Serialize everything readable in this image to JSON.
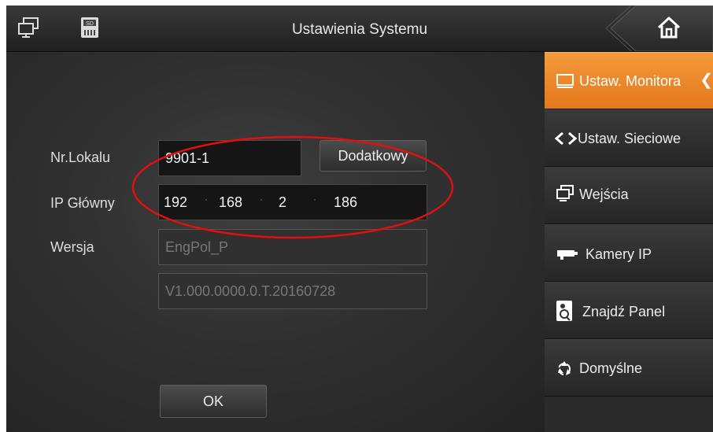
{
  "header": {
    "title": "Ustawienia Systemu",
    "icons": [
      "monitor-icon",
      "sd-card-icon"
    ],
    "home_icon": "home-icon"
  },
  "form": {
    "room_label": "Nr.Lokalu",
    "room_value": "9901-1",
    "extra_button": "Dodatkowy",
    "ip_label": "IP Główny",
    "ip": [
      "192",
      "168",
      "2",
      "186"
    ],
    "version_label": "Wersja",
    "version_name": "EngPol_P",
    "version_number": "V1.000.0000.0.T.20160728",
    "ok_button": "OK"
  },
  "sidebar": {
    "items": [
      {
        "label": "Ustaw. Monitora",
        "icon": "monitor-screen-icon",
        "active": true
      },
      {
        "label": "Ustaw. Sieciowe",
        "icon": "network-arrows-icon",
        "active": false
      },
      {
        "label": "Wejścia",
        "icon": "inputs-icon",
        "active": false
      },
      {
        "label": "Kamery IP",
        "icon": "camera-icon",
        "active": false
      },
      {
        "label": "Znajdź Panel",
        "icon": "find-panel-icon",
        "active": false
      },
      {
        "label": "Domyślne",
        "icon": "recycle-icon",
        "active": false
      }
    ]
  },
  "colors": {
    "active_tab": "#ee8a2a",
    "highlight_ellipse": "#e01010",
    "ip_separator": "#2f9fe0"
  }
}
